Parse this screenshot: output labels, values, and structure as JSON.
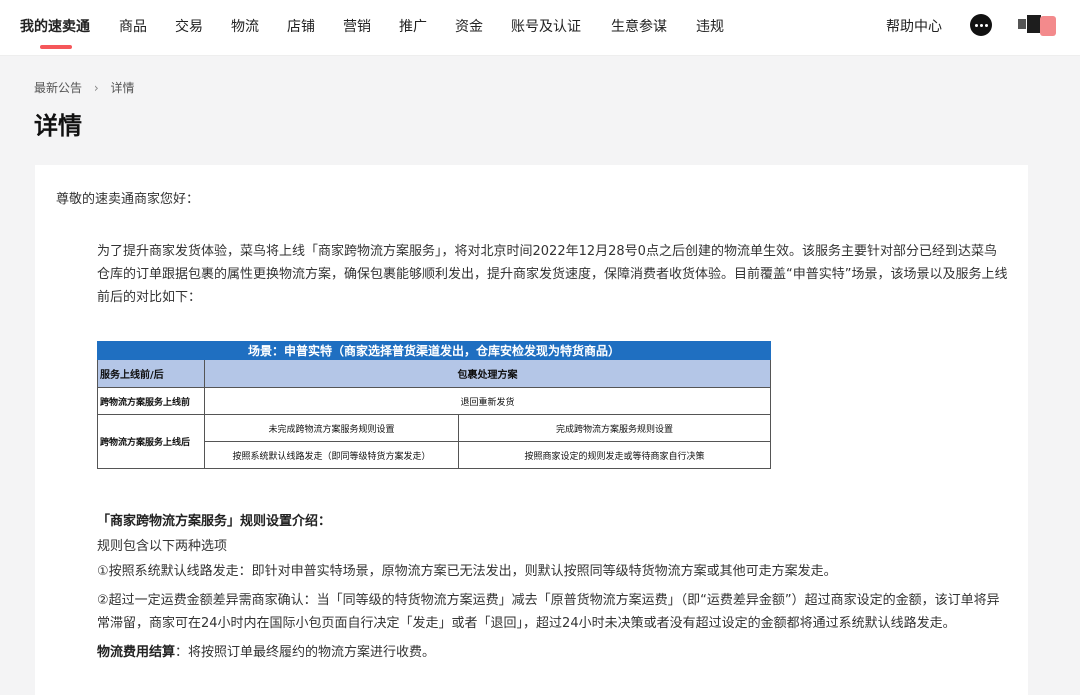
{
  "nav": {
    "items": [
      "我的速卖通",
      "商品",
      "交易",
      "物流",
      "店铺",
      "营销",
      "推广",
      "资金",
      "账号及认证",
      "生意参谋",
      "违规"
    ],
    "active_index": 0,
    "help": "帮助中心",
    "accent_color": "#f5575a"
  },
  "breadcrumb": {
    "parent": "最新公告",
    "current": "详情"
  },
  "page_title": "详情",
  "content": {
    "greeting": "尊敬的速卖通商家您好：",
    "intro": "为了提升商家发货体验，菜鸟将上线「商家跨物流方案服务」，将对北京时间2022年12月28号0点之后创建的物流单生效。该服务主要针对部分已经到达菜鸟仓库的订单跟据包裹的属性更换物流方案，确保包裹能够顺利发出，提升商家发货速度，保障消费者收货体验。目前覆盖“申普实特”场景，该场景以及服务上线前后的对比如下：",
    "table": {
      "title": "场景：申普实特（商家选择普货渠道发出，仓库安检发现为特货商品）",
      "header_col1": "服务上线前/后",
      "header_col2": "包裹处理方案",
      "row_before_label": "跨物流方案服务上线前",
      "row_before_value": "退回重新发货",
      "row_after_label": "跨物流方案服务上线后",
      "after_unset": "未完成跨物流方案服务规则设置",
      "after_set": "完成跨物流方案服务规则设置",
      "after_unset_action": "按照系统默认线路发走（即同等级特货方案发走）",
      "after_set_action": "按照商家设定的规则发走或等待商家自行决策",
      "title_color": "#1f6fc1",
      "header_color": "#b4c6e7"
    },
    "rules_heading": "「商家跨物流方案服务」规则设置介绍：",
    "rules_intro": "规则包含以下两种选项",
    "rule1": "①按照系统默认线路发走：即针对申普实特场景，原物流方案已无法发出，则默认按照同等级特货物流方案或其他可走方案发走。",
    "rule2": "②超过一定运费金额差异需商家确认：当「同等级的特货物流方案运费」减去「原普货物流方案运费」（即“运费差异金额”）超过商家设定的金额，该订单将异常滞留，商家可在24小时内在国际小包页面自行决定「发走」或者「退回」，超过24小时未决策或者没有超过设定的金额都将通过系统默认线路发走。",
    "fee_label": "物流费用结算",
    "fee_text": "：将按照订单最终履约的物流方案进行收费。"
  }
}
